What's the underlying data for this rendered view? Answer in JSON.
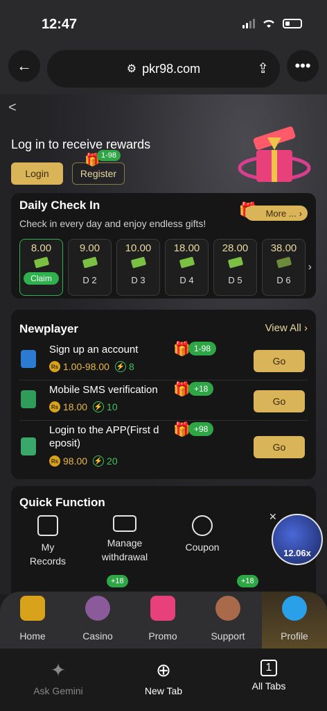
{
  "status": {
    "time": "12:47"
  },
  "browser": {
    "url": "pkr98.com",
    "back_icon": "arrow-left-icon",
    "menu_icon": "more-icon"
  },
  "hero": {
    "title": "Log in to receive rewards",
    "login": "Login",
    "register": "Register",
    "register_badge": "1-98"
  },
  "checkin": {
    "title": "Daily Check In",
    "subtitle": "Check in every day and enjoy endless gifts!",
    "more": "More ...",
    "days": [
      {
        "amount": "8.00",
        "label": "Claim",
        "active": true
      },
      {
        "amount": "9.00",
        "label": "D 2"
      },
      {
        "amount": "10.00",
        "label": "D 3"
      },
      {
        "amount": "18.00",
        "label": "D 4"
      },
      {
        "amount": "28.00",
        "label": "D 5"
      },
      {
        "amount": "38.00",
        "label": "D 6"
      }
    ]
  },
  "newplayer": {
    "title": "Newplayer",
    "view_all": "View All",
    "rows": [
      {
        "title": "Sign up an account",
        "badge": "1-98",
        "amount": "1.00-98.00",
        "points": "8",
        "go": "Go"
      },
      {
        "title": "Mobile SMS verification",
        "badge": "+18",
        "amount": "18.00",
        "points": "10",
        "go": "Go"
      },
      {
        "title": "Login to the APP(First d eposit)",
        "badge": "+98",
        "amount": "98.00",
        "points": "20",
        "go": "Go"
      }
    ]
  },
  "quick": {
    "title": "Quick Function",
    "items": [
      "My Records",
      "Manage withdrawal",
      "Coupon"
    ]
  },
  "bubble": {
    "multiplier": "12.06x"
  },
  "tabs": [
    {
      "label": "Home",
      "icon": "seven-slot-icon"
    },
    {
      "label": "Casino",
      "icon": "casino-dealer-icon",
      "badge": "+18"
    },
    {
      "label": "Promo",
      "icon": "gift-icon"
    },
    {
      "label": "Support",
      "icon": "support-agent-icon",
      "badge": "+18"
    },
    {
      "label": "Profile",
      "icon": "profile-icon",
      "active": true
    }
  ],
  "browser_bottom": {
    "gemini": "Ask Gemini",
    "new_tab": "New Tab",
    "all_tabs": "All Tabs",
    "tab_count": "1"
  }
}
